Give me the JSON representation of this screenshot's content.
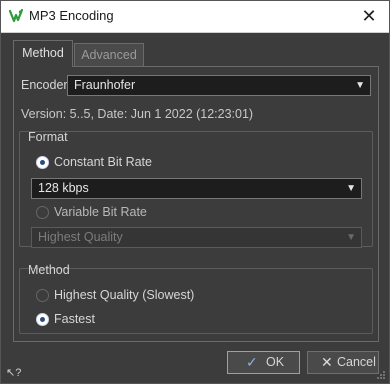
{
  "window": {
    "title": "MP3 Encoding",
    "close_glyph": "✕"
  },
  "tabs": [
    {
      "label": "Method",
      "active": true
    },
    {
      "label": "Advanced",
      "active": false
    }
  ],
  "encoder": {
    "label": "Encoder",
    "value": "Fraunhofer"
  },
  "version_text": "Version: 5..5, Date: Jun  1 2022 (12:23:01)",
  "format_group": {
    "title": "Format",
    "constant_bit_rate": {
      "label": "Constant Bit Rate",
      "checked": true
    },
    "bitrate_value": "128 kbps",
    "variable_bit_rate": {
      "label": "Variable Bit Rate",
      "checked": false
    },
    "vbr_quality_value": "Highest Quality"
  },
  "method_group": {
    "title": "Method",
    "highest_quality": {
      "label": "Highest Quality (Slowest)",
      "checked": false
    },
    "fastest": {
      "label": "Fastest",
      "checked": true
    }
  },
  "buttons": {
    "ok": {
      "label": "OK",
      "glyph": "✓"
    },
    "cancel": {
      "label": "Cancel",
      "glyph": "✕"
    }
  },
  "help_glyph": "↖?",
  "dropdown_arrow": "▼",
  "colors": {
    "accent_ok_border": "#8aa3cc",
    "radio_dot": "#2a4a85",
    "app_icon_green": "#2e9c3e"
  }
}
